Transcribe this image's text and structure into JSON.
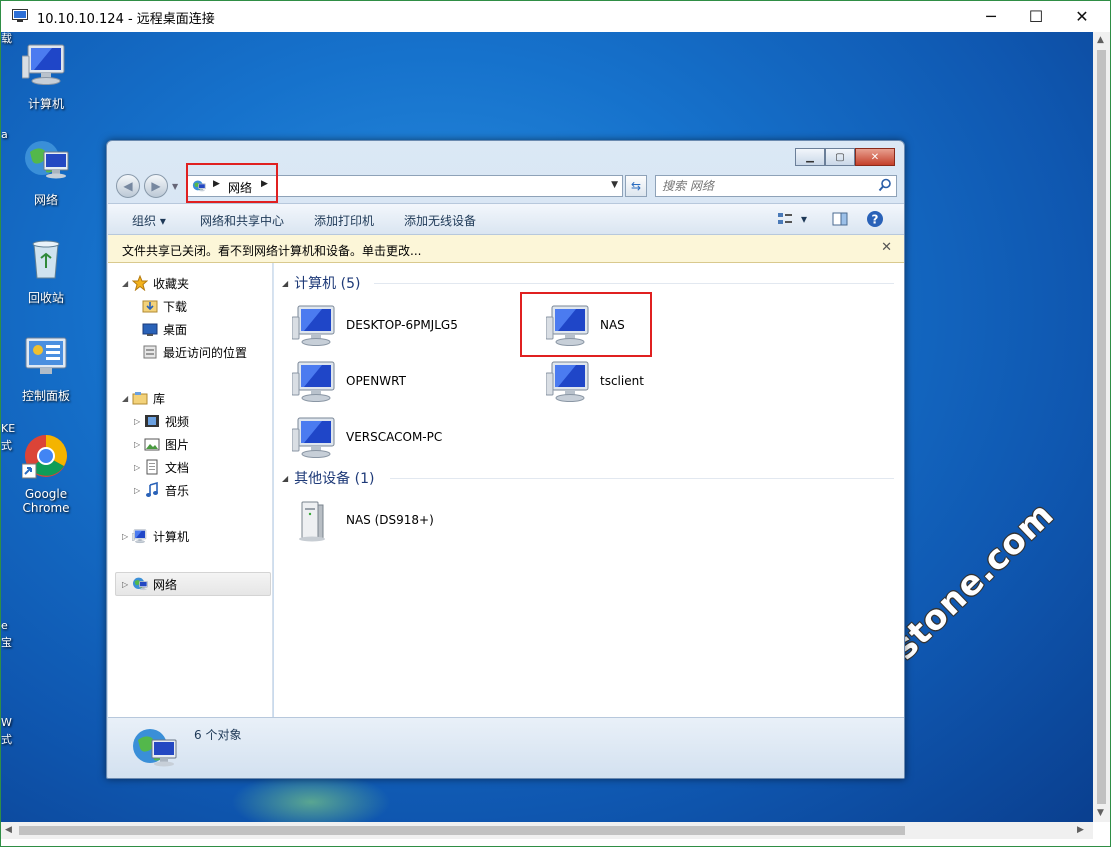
{
  "rdp": {
    "title": "10.10.10.124 - 远程桌面连接",
    "controls": {
      "minimize": "─",
      "maximize": "☐",
      "close": "✕"
    }
  },
  "desktop": {
    "icons": [
      {
        "label": "计算机",
        "icon": "computer-icon"
      },
      {
        "label": "网络",
        "icon": "network-icon"
      },
      {
        "label": "回收站",
        "icon": "recycle-bin-icon"
      },
      {
        "label": "控制面板",
        "icon": "control-panel-icon"
      },
      {
        "label": "Google Chrome",
        "icon": "chrome-icon"
      }
    ],
    "edge_fragments": [
      "载",
      "a",
      "KE",
      "式",
      "e",
      "宝",
      "W",
      "式"
    ]
  },
  "explorer": {
    "window_buttons": {
      "minimize": "▁",
      "maximize": "▢",
      "close": "✕"
    },
    "address": {
      "segment": "网络"
    },
    "search": {
      "placeholder": "搜索 网络"
    },
    "toolbar": {
      "organize": "组织 ▾",
      "network_center": "网络和共享中心",
      "add_printer": "添加打印机",
      "add_wireless": "添加无线设备",
      "view_arrow": "▾"
    },
    "infobar": {
      "message": "文件共享已关闭。看不到网络计算机和设备。单击更改...",
      "close": "✕"
    },
    "nav": {
      "favorites": "收藏夹",
      "downloads": "下载",
      "desktop": "桌面",
      "recent": "最近访问的位置",
      "libraries": "库",
      "videos": "视频",
      "pictures": "图片",
      "documents": "文档",
      "music": "音乐",
      "computer": "计算机",
      "network": "网络"
    },
    "groups": {
      "computers": {
        "header": "计算机 (5)",
        "items": [
          "DESKTOP-6PMJLG5",
          "NAS",
          "OPENWRT",
          "tsclient",
          "VERSCACOM-PC"
        ]
      },
      "other": {
        "header": "其他设备 (1)",
        "items": [
          "NAS (DS918+)"
        ]
      }
    },
    "status": {
      "count": "6 个对象"
    }
  },
  "watermark": "bndstone.com",
  "colors": {
    "desktop_blue": "#1672cc",
    "highlight_red": "#e02020",
    "group_header": "#1e3a78",
    "infobar": "#fcf6d8"
  }
}
